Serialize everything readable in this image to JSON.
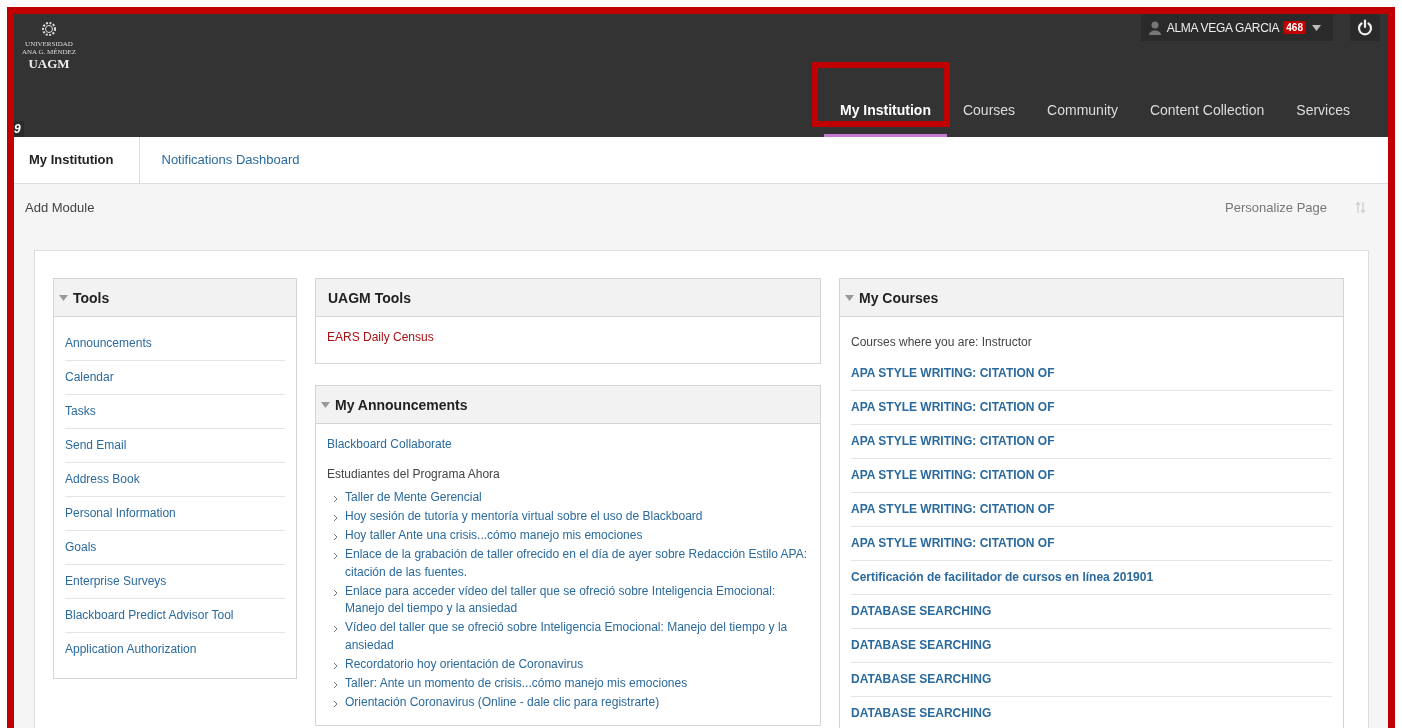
{
  "header": {
    "logo": {
      "line1": "UNIVERSIDAD",
      "line2": "ANA G. MÉNDEZ",
      "name": "UAGM"
    },
    "corner_mark": "9",
    "user": {
      "name": "ALMA VEGA GARCIA",
      "badge": "468"
    },
    "nav": [
      {
        "label": "My Institution",
        "selected": true,
        "highlighted": true
      },
      {
        "label": "Courses",
        "selected": false,
        "highlighted": false
      },
      {
        "label": "Community",
        "selected": false,
        "highlighted": false
      },
      {
        "label": "Content Collection",
        "selected": false,
        "highlighted": false
      },
      {
        "label": "Services",
        "selected": false,
        "highlighted": false
      }
    ]
  },
  "subtabs": [
    {
      "label": "My Institution",
      "selected": true
    },
    {
      "label": "Notifications Dashboard",
      "selected": false
    }
  ],
  "toolbar": {
    "add_module": "Add Module",
    "personalize": "Personalize Page"
  },
  "columns": [
    [
      {
        "kind": "tool_list",
        "title": "Tools",
        "collapsible": true,
        "items": [
          "Announcements",
          "Calendar",
          "Tasks",
          "Send Email",
          "Address Book",
          "Personal Information",
          "Goals",
          "Enterprise Surveys",
          "Blackboard Predict Advisor Tool",
          "Application Authorization"
        ]
      }
    ],
    [
      {
        "kind": "alert_list",
        "title": "UAGM Tools",
        "collapsible": false,
        "items": [
          "EARS Daily Census"
        ]
      },
      {
        "kind": "announcements",
        "title": "My Announcements",
        "collapsible": true,
        "link": "Blackboard Collaborate",
        "group": "Estudiantes del Programa Ahora",
        "items": [
          "Taller de Mente Gerencial",
          "Hoy sesión de tutoría y mentoría virtual sobre el uso de Blackboard",
          "Hoy taller Ante una crisis...cómo manejo mis emociones",
          "Enlace de la grabación de taller ofrecido en el día de ayer sobre Redacción Estilo APA: citación de las fuentes.",
          "Enlace para acceder vídeo del taller que se ofreció sobre Inteligencia Emocional: Manejo del tiempo y la ansiedad",
          "Vídeo del taller que se ofreció sobre Inteligencia Emocional: Manejo del tiempo y la ansiedad",
          "Recordatorio hoy orientación de Coronavirus",
          "Taller: Ante un momento de crisis...cómo manejo mis emociones",
          "Orientación Coronavirus (Online - dale clic para registrarte)"
        ]
      }
    ],
    [
      {
        "kind": "courses",
        "title": "My Courses",
        "collapsible": true,
        "caption": "Courses where you are: Instructor",
        "items": [
          "APA STYLE WRITING: CITATION OF",
          "APA STYLE WRITING: CITATION OF",
          "APA STYLE WRITING: CITATION OF",
          "APA STYLE WRITING: CITATION OF",
          "APA STYLE WRITING: CITATION OF",
          "APA STYLE WRITING: CITATION OF",
          "Certificación de facilitador de cursos en línea 201901",
          "DATABASE SEARCHING",
          "DATABASE SEARCHING",
          "DATABASE SEARCHING",
          "DATABASE SEARCHING"
        ]
      }
    ]
  ]
}
